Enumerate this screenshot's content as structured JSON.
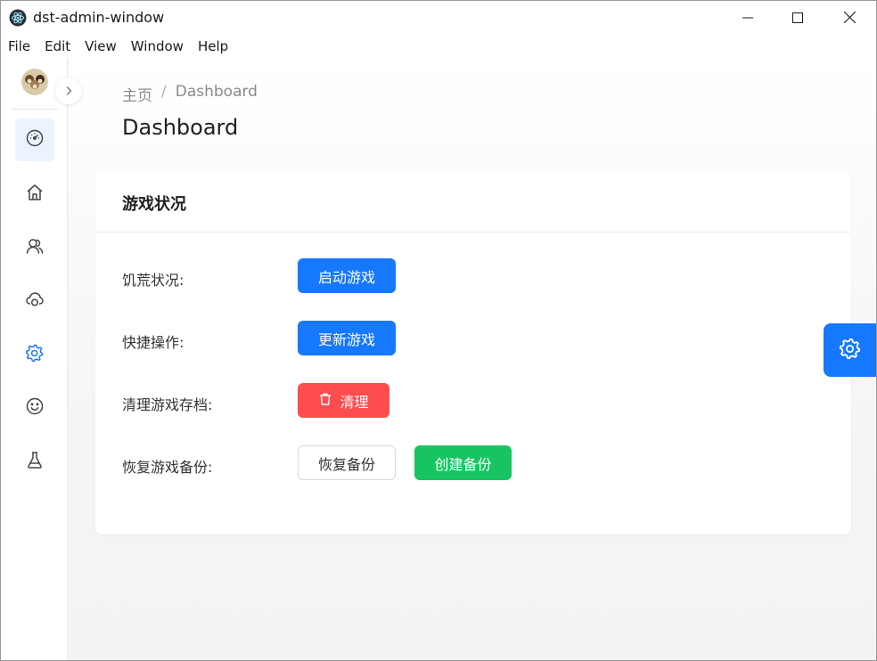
{
  "window": {
    "title": "dst-admin-window",
    "app_icon": "electron-icon",
    "controls": [
      "minimize-icon",
      "maximize-icon",
      "close-icon"
    ]
  },
  "menubar": {
    "items": [
      "File",
      "Edit",
      "View",
      "Window",
      "Help"
    ]
  },
  "sidebar": {
    "avatar": "avatar",
    "collapse_icon": "chevron-right-icon",
    "items": [
      {
        "icon": "dashboard-gauge-icon",
        "active": true
      },
      {
        "icon": "home-icon",
        "active": false
      },
      {
        "icon": "users-icon",
        "active": false
      },
      {
        "icon": "cloud-icon",
        "active": false
      },
      {
        "icon": "gear-icon",
        "active": false
      },
      {
        "icon": "smile-icon",
        "active": false
      },
      {
        "icon": "flask-icon",
        "active": false
      }
    ]
  },
  "breadcrumb": {
    "home": "主页",
    "separator": "/",
    "current": "Dashboard"
  },
  "page_title": "Dashboard",
  "card": {
    "title": "游戏状况",
    "rows": [
      {
        "label": "饥荒状况:",
        "buttons": [
          "启动游戏"
        ]
      },
      {
        "label": "快捷操作:",
        "buttons": [
          "更新游戏"
        ]
      },
      {
        "label": "清理游戏存档:",
        "buttons": [
          "清理"
        ]
      },
      {
        "label": "恢复游戏备份:",
        "buttons": [
          "恢复备份",
          "创建备份"
        ]
      }
    ]
  },
  "floating_button": {
    "icon": "gear-icon"
  },
  "colors": {
    "primary": "#1677ff",
    "danger": "#ff4d4f",
    "success": "#18c462",
    "active_nav_bg": "#eaf3ff"
  }
}
